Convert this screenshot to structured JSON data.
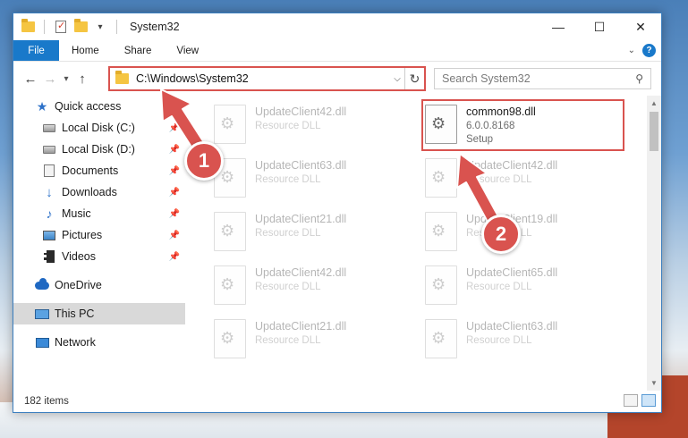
{
  "window": {
    "title": "System32",
    "minimize_glyph": "—",
    "maximize_glyph": "☐",
    "close_glyph": "✕"
  },
  "ribbon": {
    "tabs": [
      {
        "label": "File"
      },
      {
        "label": "Home"
      },
      {
        "label": "Share"
      },
      {
        "label": "View"
      }
    ]
  },
  "address": {
    "path": "C:\\Windows\\System32",
    "search_placeholder": "Search System32"
  },
  "nav": {
    "items": [
      {
        "label": "Quick access",
        "icon": "star-icon"
      },
      {
        "label": "Local Disk (C:)",
        "icon": "drive-icon",
        "pinned": true
      },
      {
        "label": "Local Disk (D:)",
        "icon": "drive-icon",
        "pinned": true
      },
      {
        "label": "Documents",
        "icon": "documents-icon",
        "pinned": true
      },
      {
        "label": "Downloads",
        "icon": "download-icon",
        "pinned": true
      },
      {
        "label": "Music",
        "icon": "music-icon",
        "pinned": true
      },
      {
        "label": "Pictures",
        "icon": "pictures-icon",
        "pinned": true
      },
      {
        "label": "Videos",
        "icon": "videos-icon",
        "pinned": true
      },
      {
        "label": "OneDrive",
        "icon": "onedrive-icon"
      },
      {
        "label": "This PC",
        "icon": "this-pc-icon",
        "selected": true
      },
      {
        "label": "Network",
        "icon": "network-icon"
      }
    ]
  },
  "files": {
    "highlighted": {
      "name": "common98.dll",
      "version": "6.0.0.8168",
      "desc": "Setup"
    },
    "left_column": [
      {
        "name": "UpdateClient42.dll",
        "desc": "Resource DLL"
      },
      {
        "name": "UpdateClient63.dll",
        "desc": "Resource DLL"
      },
      {
        "name": "UpdateClient21.dll",
        "desc": "Resource DLL"
      },
      {
        "name": "UpdateClient42.dll",
        "desc": "Resource DLL"
      },
      {
        "name": "UpdateClient21.dll",
        "desc": "Resource DLL"
      }
    ],
    "right_column": [
      {
        "name": "UpdateClient42.dll",
        "desc": "Resource DLL"
      },
      {
        "name": "UpdateClient19.dll",
        "desc": "Resource DLL"
      },
      {
        "name": "UpdateClient65.dll",
        "desc": "Resource DLL"
      },
      {
        "name": "UpdateClient63.dll",
        "desc": "Resource DLL"
      }
    ]
  },
  "status": {
    "item_count": "182 items"
  },
  "annotations": {
    "step1": "1",
    "step2": "2",
    "accent": "#d9534f"
  }
}
